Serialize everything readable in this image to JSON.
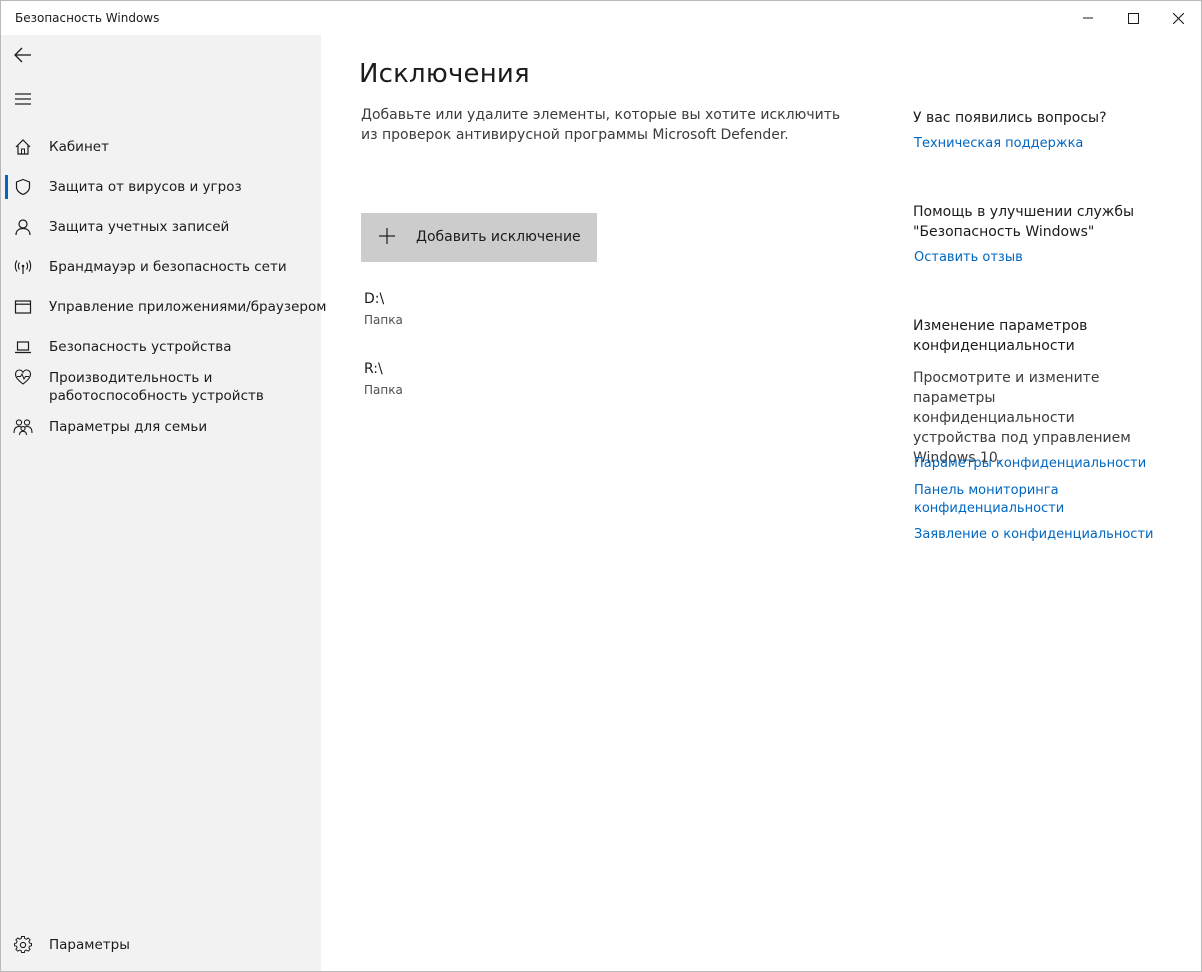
{
  "window": {
    "title": "Безопасность Windows"
  },
  "sidebar": {
    "back_icon": "back-arrow-icon",
    "menu_icon": "hamburger-icon",
    "items": [
      {
        "label": "Кабинет",
        "icon": "home-icon"
      },
      {
        "label": "Защита от вирусов и угроз",
        "icon": "shield-icon",
        "active": true
      },
      {
        "label": "Защита учетных записей",
        "icon": "person-icon"
      },
      {
        "label": "Брандмауэр и безопасность сети",
        "icon": "antenna-icon"
      },
      {
        "label": "Управление приложениями/браузером",
        "icon": "app-window-icon"
      },
      {
        "label": "Безопасность устройства",
        "icon": "laptop-icon"
      },
      {
        "label": "Производительность и работоспособность устройств",
        "icon": "heart-pulse-icon"
      },
      {
        "label": "Параметры для семьи",
        "icon": "family-icon"
      }
    ],
    "settings_label": "Параметры",
    "accent": "#0067c0"
  },
  "main": {
    "title": "Исключения",
    "description": "Добавьте или удалите элементы, которые вы хотите исключить из проверок антивирусной программы Microsoft Defender.",
    "add_button_label": "Добавить исключение",
    "exclusions": [
      {
        "path": "D:\\",
        "kind": "Папка"
      },
      {
        "path": "R:\\",
        "kind": "Папка"
      }
    ]
  },
  "right": {
    "questions_heading": "У вас появились вопросы?",
    "support_link": "Техническая поддержка",
    "feedback_heading": "Помощь в улучшении службы \"Безопасность Windows\"",
    "feedback_link": "Оставить отзыв",
    "privacy_heading": "Изменение параметров конфиденциальности",
    "privacy_text": "Просмотрите и измените параметры конфиденциальности устройства под управлением Windows 10.",
    "privacy_links": [
      "Параметры конфиденциальности",
      "Панель мониторинга конфиденциальности",
      "Заявление о конфиденциальности"
    ]
  }
}
